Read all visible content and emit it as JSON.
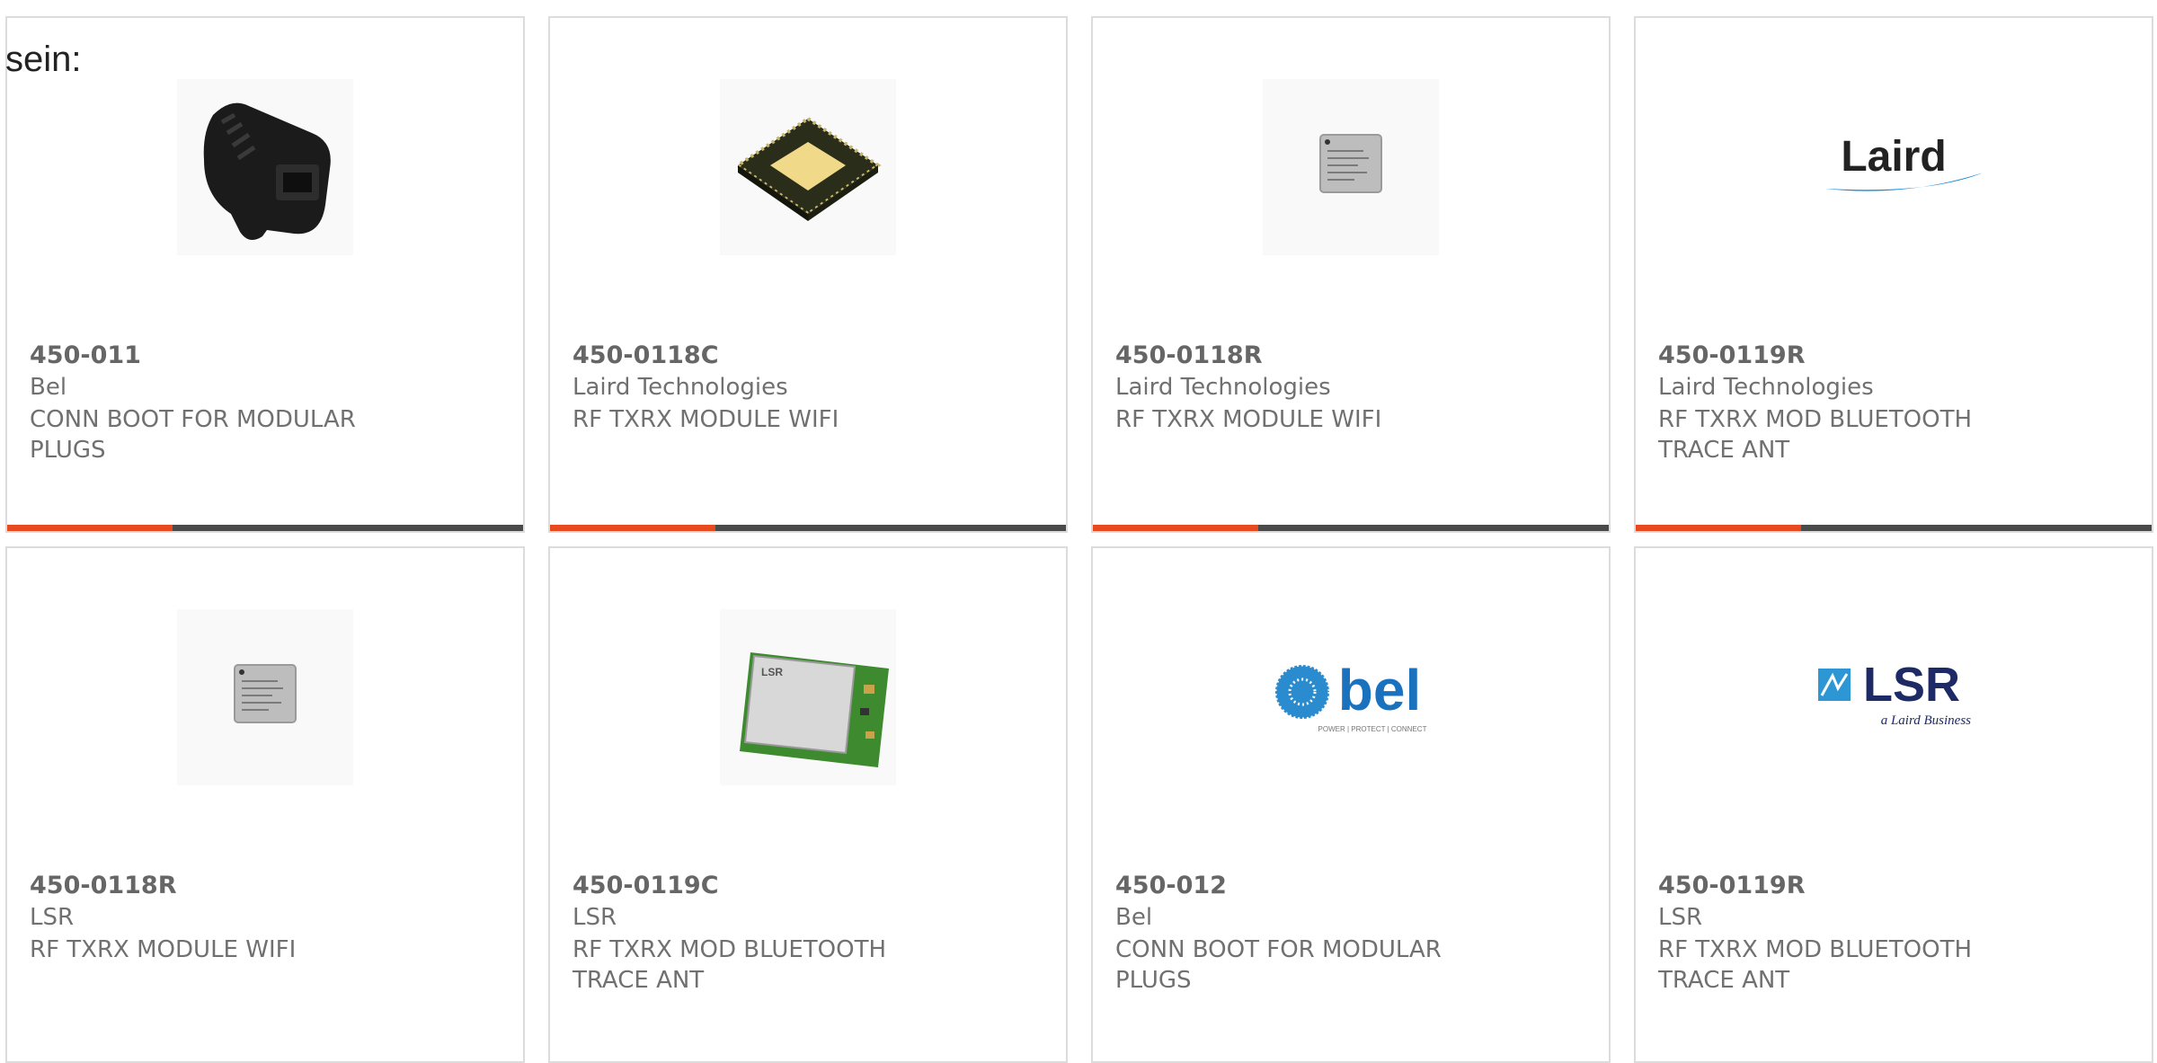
{
  "lead_text": "sein:",
  "colors": {
    "accent": "#e84a1f",
    "bar": "#4a4a4a",
    "border": "#dcdcdc"
  },
  "products": [
    {
      "part": "450-011",
      "manufacturer": "Bel",
      "description": "CONN BOOT FOR MODULAR PLUGS",
      "image": "rj45-boot",
      "progress": 0.32
    },
    {
      "part": "450-0118C",
      "manufacturer": "Laird Technologies",
      "description": "RF TXRX MODULE WIFI",
      "image": "qfn-chip",
      "progress": 0.32
    },
    {
      "part": "450-0118R",
      "manufacturer": "Laird Technologies",
      "description": "RF TXRX MODULE WIFI",
      "image": "small-silver-chip",
      "progress": 0.32
    },
    {
      "part": "450-0119R",
      "manufacturer": "Laird Technologies",
      "description": "RF TXRX MOD BLUETOOTH TRACE ANT",
      "image": "laird-logo",
      "logo_text": "Laird",
      "progress": 0.32
    },
    {
      "part": "450-0118R",
      "manufacturer": "LSR",
      "description": "RF TXRX MODULE WIFI",
      "image": "small-silver-chip"
    },
    {
      "part": "450-0119C",
      "manufacturer": "LSR",
      "description": "RF TXRX MOD BLUETOOTH TRACE ANT",
      "image": "lsr-module",
      "chip_label": "LSR"
    },
    {
      "part": "450-012",
      "manufacturer": "Bel",
      "description": "CONN BOOT FOR MODULAR PLUGS",
      "image": "bel-logo",
      "logo_text": "bel",
      "logo_tagline": "POWER | PROTECT | CONNECT"
    },
    {
      "part": "450-0119R",
      "manufacturer": "LSR",
      "description": "RF TXRX MOD BLUETOOTH TRACE ANT",
      "image": "lsr-logo",
      "logo_text": "LSR",
      "logo_tagline": "a Laird Business"
    }
  ]
}
